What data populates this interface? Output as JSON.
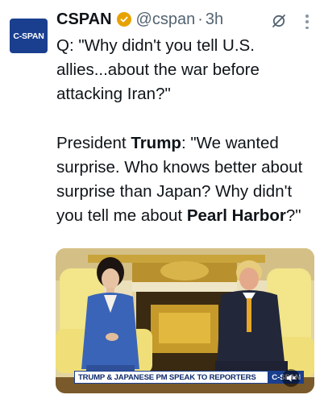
{
  "author": {
    "avatar_text": "C-SPAN",
    "name": "CSPAN",
    "handle": "@cspan",
    "separator": "·",
    "time": "3h"
  },
  "tweet": {
    "para1": "Q: \"Why didn't you tell U.S. allies...about the war before attacking Iran?\"",
    "para2_prefix": "President ",
    "para2_bold1": "Trump",
    "para2_mid": ": \"We wanted surprise. Who knows better about surprise than Japan? Why didn't you tell me about ",
    "para2_bold2": "Pearl Harbor",
    "para2_suffix": "?\""
  },
  "media": {
    "chyron_text": "TRUMP & JAPANESE PM SPEAK TO REPORTERS",
    "chyron_logo": "C-SPAN"
  },
  "icons": {
    "verified": "verified-badge-icon",
    "grok": "grok-icon",
    "more": "more-icon",
    "mute": "mute-icon"
  },
  "colors": {
    "verified_gold": "#e8a200",
    "cspan_blue": "#1a3f8f",
    "text": "#0f1419",
    "secondary": "#536471"
  }
}
